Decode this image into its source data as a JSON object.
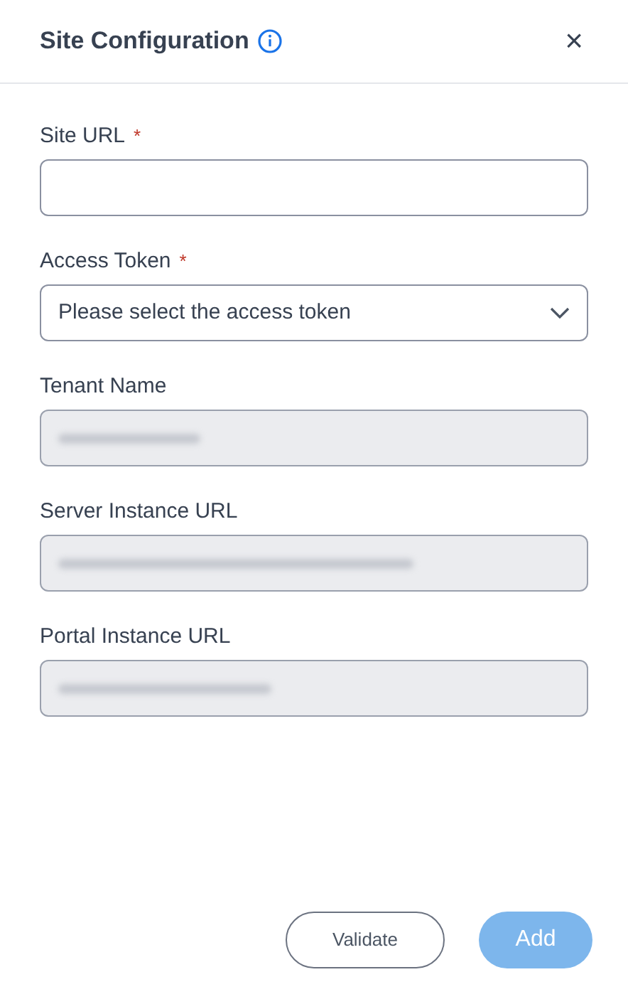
{
  "dialog": {
    "title": "Site Configuration",
    "close": "×"
  },
  "fields": [
    {
      "kind": "text",
      "label": "Site URL",
      "disabled": false,
      "required_mark": "*"
    },
    {
      "kind": "select",
      "label": "Access Token",
      "disabled": false,
      "required_mark": "*",
      "placeholder": "Please select the access token"
    },
    {
      "kind": "redacted",
      "label": "Tenant Name",
      "disabled": true
    },
    {
      "kind": "redacted",
      "label": "Server Instance URL",
      "disabled": true
    },
    {
      "kind": "redacted",
      "label": "Portal Instance URL",
      "disabled": true
    }
  ],
  "buttons": [
    {
      "kind": "outline",
      "label": "Validate",
      "disabled": false
    },
    {
      "kind": "primary",
      "label": "Add",
      "disabled": true
    }
  ]
}
